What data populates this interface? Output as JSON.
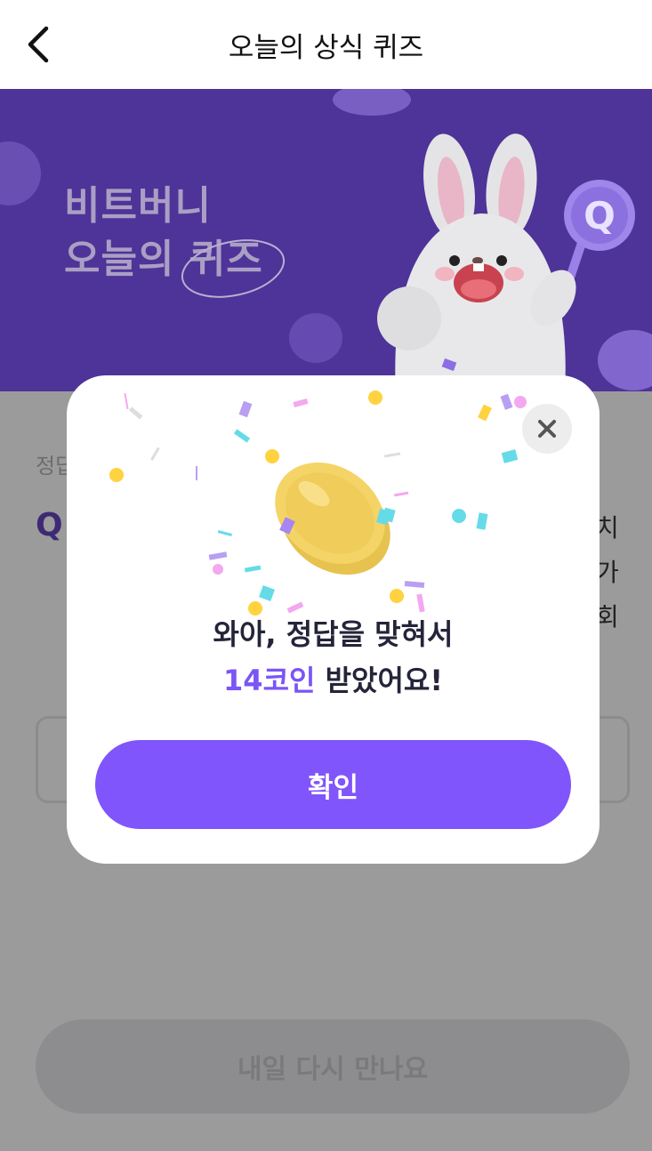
{
  "header": {
    "title": "오늘의 상식 퀴즈",
    "back_icon": "chevron-left-icon"
  },
  "banner": {
    "line1": "비트버니",
    "line2_prefix": "오늘의 ",
    "line2_highlight": "퀴즈",
    "bg": "#4e3398"
  },
  "content": {
    "answer_label": "정답",
    "q_mark": "Q",
    "right_fragments": [
      "치",
      "가",
      "회"
    ],
    "bottom_button": "내일 다시 만나요"
  },
  "modal": {
    "line1": "와아, 정답을 맞혀서",
    "coin_amount": "14코인",
    "line2_suffix": " 받았어요!",
    "confirm_label": "확인",
    "close_icon": "close-icon",
    "accent": "#8055fb"
  }
}
